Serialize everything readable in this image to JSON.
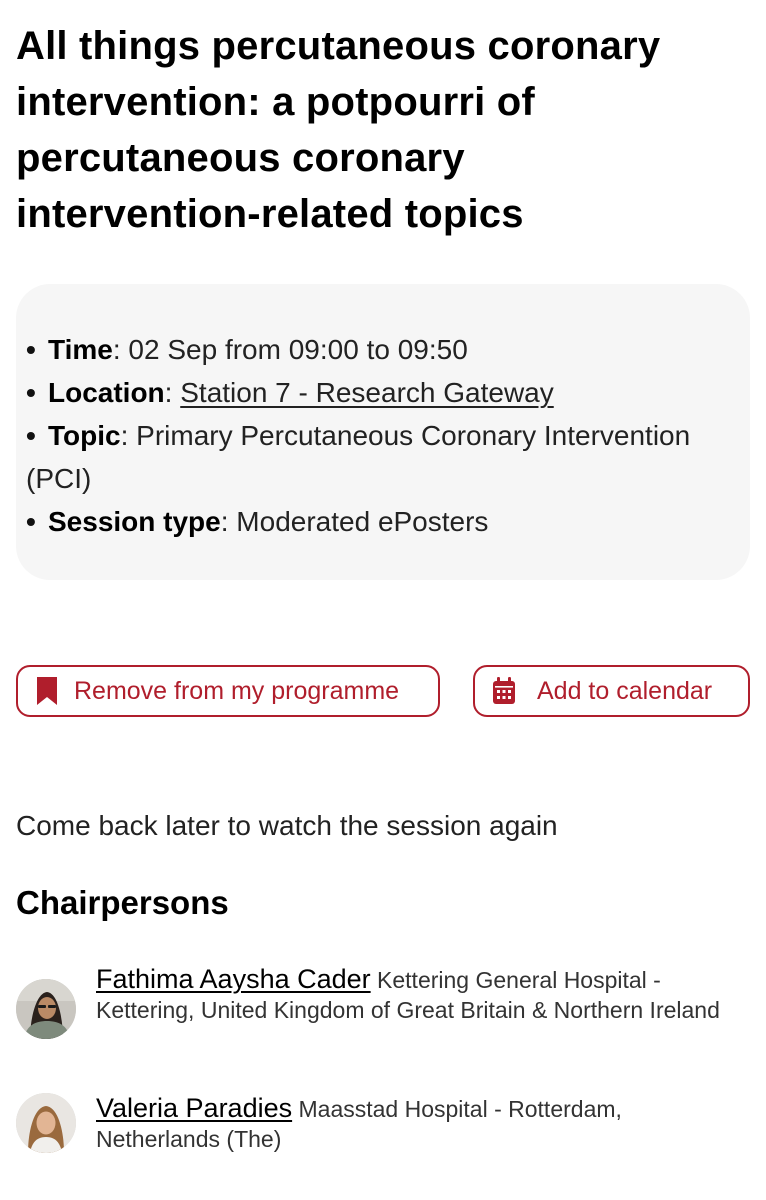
{
  "session": {
    "title": "All things percutaneous coronary intervention: a potpourri of percutaneous coronary intervention-related topics"
  },
  "info": {
    "bullet": "•",
    "time_label": "Time",
    "time_value": "02 Sep from 09:00 to 09:50",
    "location_label": "Location",
    "location_value": "Station 7 - Research Gateway",
    "topic_label": "Topic",
    "topic_value": "Primary Percutaneous Coronary Intervention (PCI)",
    "session_type_label": "Session type",
    "session_type_value": "Moderated ePosters",
    "separator": ": "
  },
  "actions": {
    "remove_label": "Remove from my programme",
    "calendar_label": "Add to calendar",
    "accent_color": "#b01e2c"
  },
  "watch_note": "Come back later to watch the session again",
  "chairpersons": {
    "heading": "Chairpersons",
    "people": [
      {
        "name": "Fathima Aaysha Cader",
        "affiliation": "Kettering General Hospital - Kettering, United Kingdom of Great Britain & Northern Ireland"
      },
      {
        "name": "Valeria Paradies",
        "affiliation": "Maasstad Hospital - Rotterdam, Netherlands (The)"
      }
    ]
  }
}
